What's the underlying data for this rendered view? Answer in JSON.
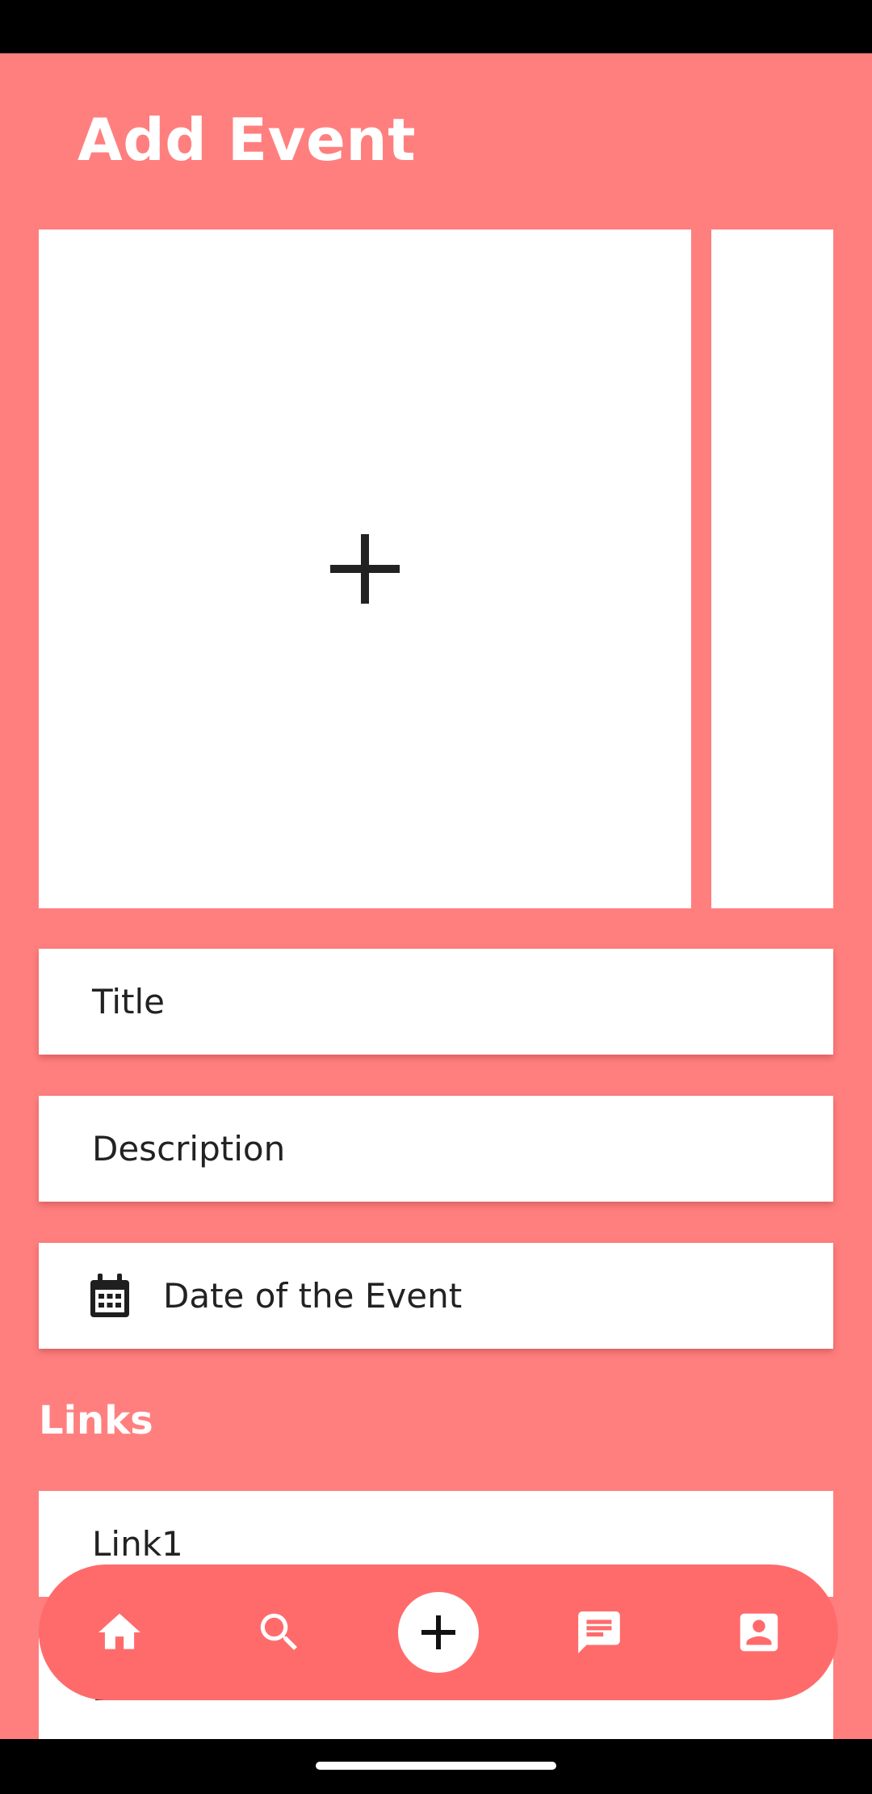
{
  "page": {
    "title": "Add Event"
  },
  "images": {
    "add_icon": "plus-icon"
  },
  "form": {
    "title_placeholder": "Title",
    "description_placeholder": "Description",
    "date_placeholder": "Date of the Event",
    "date_icon": "calendar-icon"
  },
  "links": {
    "heading": "Links",
    "items": [
      {
        "label": "Link1"
      },
      {
        "label": "Link2"
      }
    ]
  },
  "bottom_nav": {
    "items": [
      {
        "icon": "home-icon"
      },
      {
        "icon": "search-icon"
      },
      {
        "icon": "add-icon"
      },
      {
        "icon": "chat-icon"
      },
      {
        "icon": "profile-icon"
      }
    ]
  },
  "colors": {
    "background": "#ff7f7f",
    "nav_background": "#ff6b6b",
    "surface": "#ffffff",
    "text": "#222222"
  }
}
